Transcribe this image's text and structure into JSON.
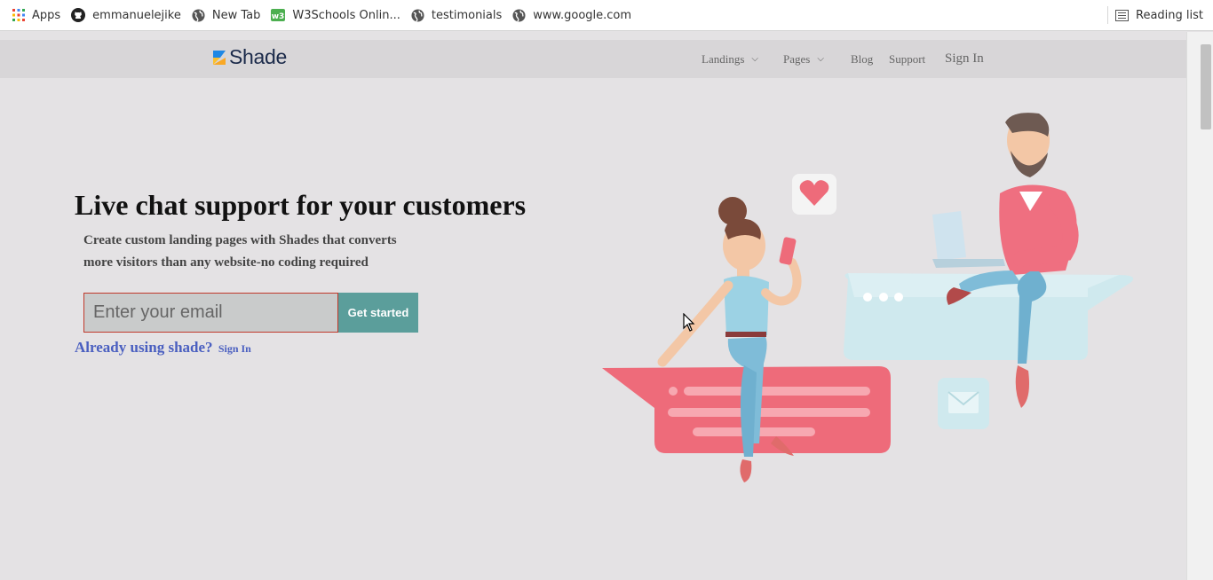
{
  "bookmarks": {
    "items": [
      {
        "label": "Apps",
        "icon": "apps-grid-icon"
      },
      {
        "label": "emmanuelejike",
        "icon": "github-icon"
      },
      {
        "label": "New Tab",
        "icon": "globe-icon"
      },
      {
        "label": "W3Schools Onlin...",
        "icon": "w3schools-icon"
      },
      {
        "label": "testimonials",
        "icon": "globe-icon"
      },
      {
        "label": "www.google.com",
        "icon": "globe-icon"
      }
    ],
    "reading_list": "Reading list"
  },
  "nav": {
    "logo": "Shade",
    "landings": "Landings",
    "pages": "Pages",
    "blog": "Blog",
    "support": "Support",
    "signin": "Sign In"
  },
  "hero": {
    "title": "Live chat support for your customers",
    "subtitle_line1": "Create custom landing pages with Shades that converts",
    "subtitle_line2": "more visitors than any website-no coding required",
    "email_placeholder": "Enter your email",
    "cta": "Get started",
    "already": "Already using shade?",
    "signin_link": "Sign In"
  },
  "colors": {
    "page_bg": "#e4e2e4",
    "nav_bg": "#d8d6d8",
    "cta_bg": "#5b9e9b",
    "link": "#4a5fc0",
    "input_border": "#c0392b",
    "bubble_pink": "#ee6b7a",
    "bubble_blue": "#cfe9ee"
  }
}
